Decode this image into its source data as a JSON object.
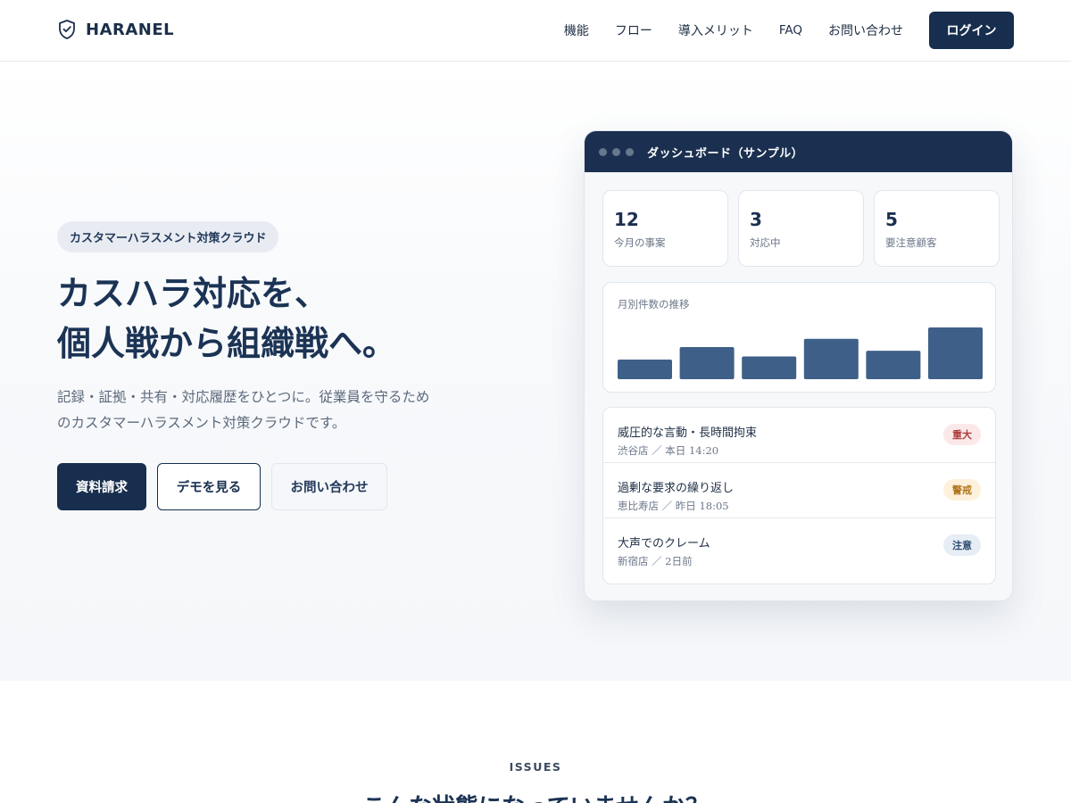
{
  "header": {
    "brand": "HARANEL",
    "nav": [
      "機能",
      "フロー",
      "導入メリット",
      "FAQ",
      "お問い合わせ"
    ],
    "login_label": "ログイン"
  },
  "hero": {
    "badge": "カスタマーハラスメント対策クラウド",
    "title_line1": "カスハラ対応を、",
    "title_line2": "個人戦から組織戦へ。",
    "description": "記録・証拠・共有・対応履歴をひとつに。従業員を守るためのカスタマーハラスメント対策クラウドです。",
    "cta_primary": "資料請求",
    "cta_secondary": "デモを見る",
    "cta_tertiary": "お問い合わせ"
  },
  "dashboard": {
    "title": "ダッシュボード（サンプル）",
    "stats": [
      {
        "value": "12",
        "label": "今月の事案"
      },
      {
        "value": "3",
        "label": "対応中"
      },
      {
        "value": "5",
        "label": "要注意顧客"
      }
    ],
    "chart_title": "月別件数の推移",
    "incidents": [
      {
        "title": "威圧的な言動・長時間拘束",
        "meta": "渋谷店 ／ 本日 14:20",
        "level": "重大",
        "bg": "#fbe9e9",
        "fg": "#b03b3b"
      },
      {
        "title": "過剰な要求の繰り返し",
        "meta": "恵比寿店 ／ 昨日 18:05",
        "level": "警戒",
        "bg": "#fdf1dc",
        "fg": "#b0761c"
      },
      {
        "title": "大声でのクレーム",
        "meta": "新宿店 ／ 2日前",
        "level": "注意",
        "bg": "#e6edf5",
        "fg": "#2c4a6e"
      }
    ]
  },
  "chart_data": {
    "type": "bar",
    "title": "月別件数の推移",
    "values": [
      0.38,
      0.62,
      0.44,
      0.78,
      0.55,
      1.0
    ],
    "bar_color": "#3e6088"
  },
  "issues": {
    "eyebrow": "ISSUES",
    "title": "こんな状態になっていませんか？"
  },
  "colors": {
    "primary": "#172e4e",
    "accent_bar": "#3e6088"
  }
}
